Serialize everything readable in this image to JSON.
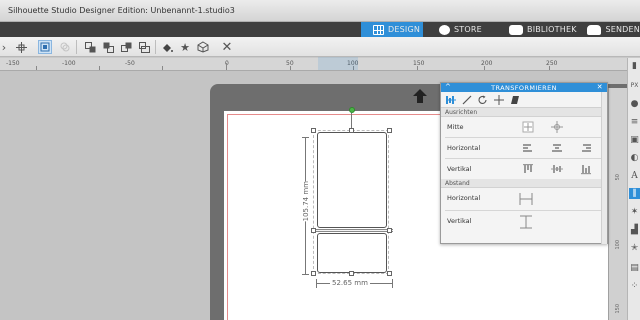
{
  "window": {
    "title": "Silhouette Studio Designer Edition: Unbenannt-1.studio3"
  },
  "nav": {
    "tabs": [
      {
        "label": "DESIGN",
        "icon": "grid-icon",
        "active": true
      },
      {
        "label": "STORE",
        "icon": "store-icon",
        "active": false
      },
      {
        "label": "BIBLIOTHEK",
        "icon": "library-icon",
        "active": false
      },
      {
        "label": "SENDEN",
        "icon": "send-icon",
        "active": false
      }
    ],
    "active_color": "#2f8fd8",
    "bar_color": "#3f3f3f"
  },
  "toolbar": {
    "icons": [
      "align-center-icon",
      "snap-icon",
      "group-icon",
      "ungroup-icon",
      "bring-forward-icon",
      "send-backward-icon",
      "bring-to-front-icon",
      "send-to-back-icon",
      "fill-icon",
      "star-icon",
      "replicate-icon",
      "delete-icon"
    ]
  },
  "ruler": {
    "labels": [
      "-150",
      "-100",
      "-50",
      "0",
      "50",
      "100",
      "150",
      "200",
      "250"
    ]
  },
  "vertical_ruler": {
    "labels": [
      "50",
      "100",
      "150"
    ]
  },
  "canvas": {
    "height_label": "105.74 mm",
    "width_label": "52.65 mm"
  },
  "transform_panel": {
    "title": "TRANSFORMIEREN",
    "tab_icons": [
      "align-icon",
      "line-icon",
      "rotate-icon",
      "move-icon",
      "shear-icon"
    ],
    "sections": {
      "align": "Ausrichten",
      "spacing": "Abstand"
    },
    "align_rows": [
      {
        "label": "Mitte"
      },
      {
        "label": "Horizontal"
      },
      {
        "label": "Vertikal"
      }
    ],
    "spacing_rows": [
      {
        "label": "Horizontal"
      },
      {
        "label": "Vertikal"
      }
    ]
  },
  "rightbar": {
    "icons": [
      "page-icon",
      "pixscan-icon",
      "fill-color-icon",
      "line-style-icon",
      "library-small-icon",
      "color-icon",
      "text-icon",
      "transform-icon",
      "offset-icon",
      "trace-icon",
      "star-icon",
      "send-icon",
      "dots-icon"
    ]
  }
}
